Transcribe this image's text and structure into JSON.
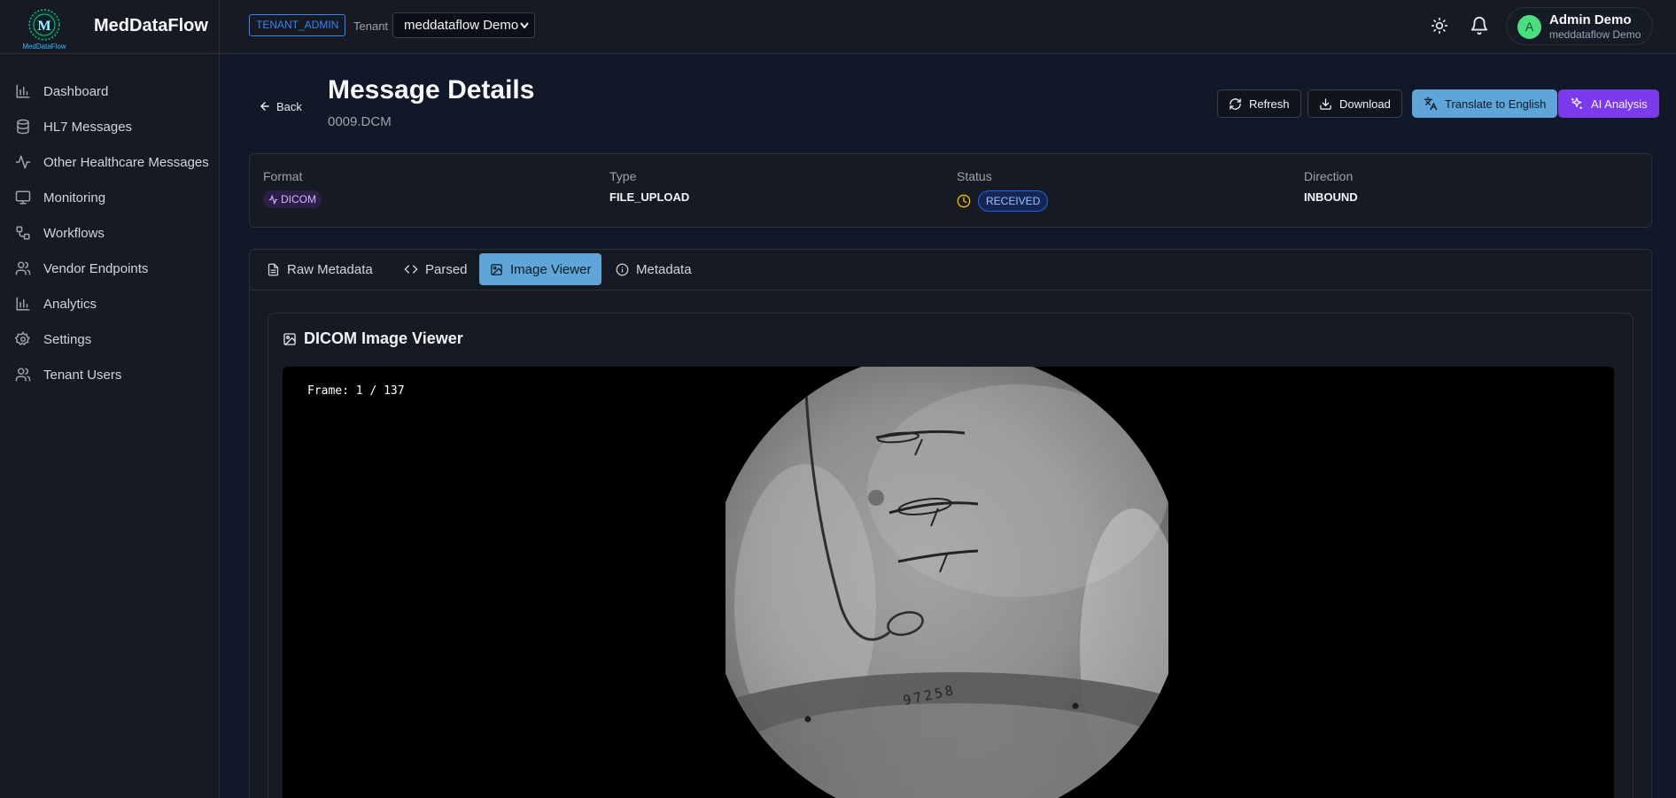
{
  "app": {
    "name": "MedDataFlow",
    "logo_text": "MedDataFlow",
    "logo_letter": "M",
    "role_badge": "TENANT_ADMIN",
    "tenant_label": "Tenant",
    "tenant_selected": "meddataflow Demo"
  },
  "user": {
    "initial": "A",
    "name": "Admin Demo",
    "org": "meddataflow Demo"
  },
  "sidebar": {
    "items": [
      {
        "label": "Dashboard",
        "icon": "bar-chart-icon"
      },
      {
        "label": "HL7 Messages",
        "icon": "database-icon"
      },
      {
        "label": "Other Healthcare Messages",
        "icon": "activity-icon"
      },
      {
        "label": "Monitoring",
        "icon": "monitor-icon"
      },
      {
        "label": "Workflows",
        "icon": "workflow-icon"
      },
      {
        "label": "Vendor Endpoints",
        "icon": "users-icon"
      },
      {
        "label": "Analytics",
        "icon": "bar-chart-icon"
      },
      {
        "label": "Settings",
        "icon": "gear-icon"
      },
      {
        "label": "Tenant Users",
        "icon": "users-icon"
      }
    ]
  },
  "header": {
    "back_label": "Back",
    "title": "Message Details",
    "subtitle": "0009.DCM",
    "actions": {
      "refresh": "Refresh",
      "download": "Download",
      "translate": "Translate to English",
      "ai": "AI Analysis"
    }
  },
  "info": {
    "format_label": "Format",
    "format_value": "DICOM",
    "type_label": "Type",
    "type_value": "FILE_UPLOAD",
    "status_label": "Status",
    "status_value": "RECEIVED",
    "direction_label": "Direction",
    "direction_value": "INBOUND"
  },
  "tabs": [
    {
      "label": "Raw Metadata"
    },
    {
      "label": "Parsed"
    },
    {
      "label": "Image Viewer",
      "active": true
    },
    {
      "label": "Metadata"
    }
  ],
  "viewer": {
    "title": "DICOM Image Viewer",
    "frame_text": "Frame: 1 / 137",
    "image_number_text": "97258"
  },
  "colors": {
    "accent_blue": "#60a5d8",
    "accent_purple": "#7c3aed",
    "status_clock": "#eab308"
  }
}
